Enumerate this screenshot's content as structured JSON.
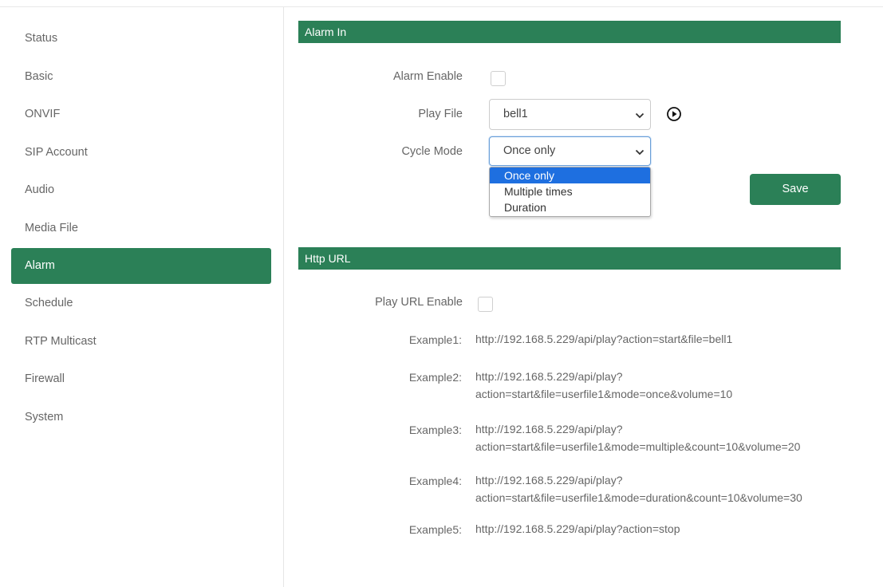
{
  "sidebar": {
    "items": [
      {
        "label": "Status"
      },
      {
        "label": "Basic"
      },
      {
        "label": "ONVIF"
      },
      {
        "label": "SIP Account"
      },
      {
        "label": "Audio"
      },
      {
        "label": "Media File"
      },
      {
        "label": "Alarm",
        "active": true
      },
      {
        "label": "Schedule"
      },
      {
        "label": "RTP Multicast"
      },
      {
        "label": "Firewall"
      },
      {
        "label": "System"
      }
    ]
  },
  "alarm_in": {
    "title": "Alarm In",
    "alarm_enable_label": "Alarm Enable",
    "alarm_enable_checked": false,
    "play_file_label": "Play File",
    "play_file_value": "bell1",
    "cycle_mode_label": "Cycle Mode",
    "cycle_mode_value": "Once only",
    "cycle_mode_options": [
      "Once only",
      "Multiple times",
      "Duration"
    ],
    "save_label": "Save"
  },
  "http_url": {
    "title": "Http URL",
    "play_url_enable_label": "Play URL Enable",
    "play_url_enable_checked": false,
    "examples": [
      {
        "label": "Example1:",
        "line1": "http://192.168.5.229/api/play?action=start&file=bell1",
        "line2": ""
      },
      {
        "label": "Example2:",
        "line1": "http://192.168.5.229/api/play?",
        "line2": "action=start&file=userfile1&mode=once&volume=10"
      },
      {
        "label": "Example3:",
        "line1": "http://192.168.5.229/api/play?",
        "line2": "action=start&file=userfile1&mode=multiple&count=10&volume=20"
      },
      {
        "label": "Example4:",
        "line1": "http://192.168.5.229/api/play?",
        "line2": "action=start&file=userfile1&mode=duration&count=10&volume=30"
      },
      {
        "label": "Example5:",
        "line1": "http://192.168.5.229/api/play?action=stop",
        "line2": ""
      }
    ]
  },
  "colors": {
    "accent": "#2b8057",
    "dropdown_highlight": "#1e6fe0"
  }
}
